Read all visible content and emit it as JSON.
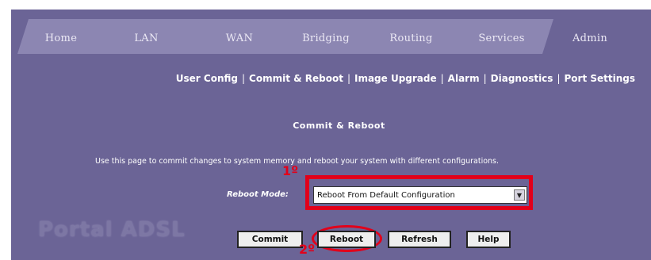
{
  "tabs": [
    {
      "label": "Home",
      "active": false
    },
    {
      "label": "LAN",
      "active": false
    },
    {
      "label": "WAN",
      "active": false
    },
    {
      "label": "Bridging",
      "active": false
    },
    {
      "label": "Routing",
      "active": false
    },
    {
      "label": "Services",
      "active": false
    },
    {
      "label": "Admin",
      "active": true
    }
  ],
  "subnav": [
    "User Config",
    "Commit & Reboot",
    "Image Upgrade",
    "Alarm",
    "Diagnostics",
    "Port Settings"
  ],
  "page": {
    "title": "Commit & Reboot",
    "description": "Use this page to commit changes to system memory and reboot your system with different configurations."
  },
  "form": {
    "reboot_mode_label": "Reboot Mode:",
    "reboot_mode_value": "Reboot From Default Configuration"
  },
  "buttons": {
    "commit": "Commit",
    "reboot": "Reboot",
    "refresh": "Refresh",
    "help": "Help"
  },
  "annotations": {
    "step1": "1º",
    "step2": "2º"
  },
  "watermark": "Portal ADSL",
  "colors": {
    "panel": "#6b6496",
    "tab": "#8c86b2",
    "tab_active": "#6b6496",
    "highlight": "#e2001a"
  }
}
